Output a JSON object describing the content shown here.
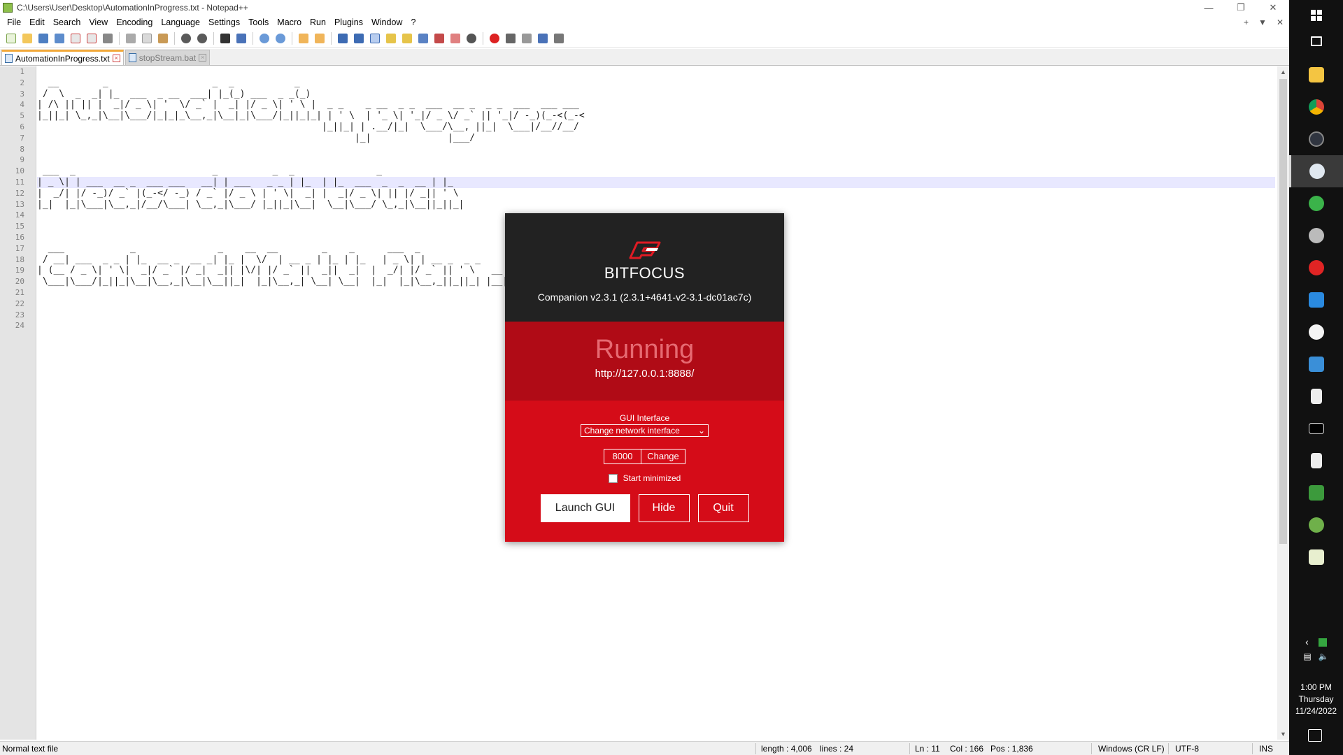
{
  "notepad": {
    "window_title": "C:\\Users\\User\\Desktop\\AutomationInProgress.txt - Notepad++",
    "menu": [
      "File",
      "Edit",
      "Search",
      "View",
      "Encoding",
      "Language",
      "Settings",
      "Tools",
      "Macro",
      "Run",
      "Plugins",
      "Window",
      "?"
    ],
    "tabs": [
      {
        "label": "AutomationInProgress.txt",
        "active": true
      },
      {
        "label": "stopStream.bat",
        "active": false
      }
    ],
    "line_numbers": [
      "1",
      "2",
      "3",
      "4",
      "5",
      "6",
      "7",
      "8",
      "9",
      "10",
      "11",
      "12",
      "13",
      "14",
      "15",
      "16",
      "17",
      "18",
      "19",
      "20",
      "21",
      "22",
      "23",
      "24"
    ],
    "current_line": 11,
    "lines": [
      "",
      "  __        _                   _  _           _",
      " /  \\  _  _| |_  ___  _ __  ___| |_(_) ___  _ _(_)",
      "| /\\ || || |  _|/ _ \\| '  \\/ _` |  _| |/ _ \\| ' \\ |  _ _    _ __  _ _  ___  __ _  _ _  ___  ___ ___",
      "|_||_| \\_,_|\\__|\\___/|_|_|_\\__,_|\\__|_|\\___/|_||_|_| | ' \\  | '_ \\| '_|/ _ \\/ _` || '_|/ -_)(_-<(_-<",
      "                                                    |_||_| | .__/|_|  \\___/\\__, ||_|  \\___|/__//__/",
      "                                                          |_|              |___/",
      "",
      "",
      " ___  _                         _          _  _               _",
      "| _ \\| | ___  __ _  ___ ___   __| | ___   _ _ | |_  | |_  ___  _  _  __ | |_",
      "|  _/| |/ -_)/ _` |(_-</ -_) / _` |/ _ \\ | ' \\|  _| |  _|/ _ \\| || |/ _|| ' \\",
      "|_|  |_|\\___|\\__,_|/__/\\___| \\__,_|\\___/ |_||_|\\__|  \\__|\\___/ \\_,_|\\__||_||_|",
      "",
      "",
      "",
      "  ___            _               _    __  __        _    _      ___  _                    ___  ___  ___  ___",
      " / __| ___  _ _ | |_  __ _  __ _| |_ |  \\/  | __ _ | |_ | |_   | _ \\| | __ _  _ _        |__ /|_  )|_  )|_  )",
      "| (__ / _ \\| ' \\|  _|/ _` |/ _|  _|| |\\/| |/ _` ||  _||  _|  |  _/| |/ _` || ' \\   __   |_ \\ / /  / /  / /",
      " \\___|\\___/|_||_|\\__|\\__,_|\\__|\\__||_|  |_|\\__,_| \\__| \\__|  |_|  |_|\\__,_||_||_| |__| |___//_/  /_/  /_/",
      "",
      "",
      "",
      ""
    ],
    "status": {
      "file_type": "Normal text file",
      "length": "length : 4,006",
      "lines": "lines : 24",
      "ln": "Ln : 11",
      "col": "Col : 166",
      "pos": "Pos : 1,836",
      "eol": "Windows (CR LF)",
      "encoding": "UTF-8",
      "mode": "INS"
    }
  },
  "companion": {
    "brand": "BITFOCUS",
    "version": "Companion v2.3.1 (2.3.1+4641-v2-3.1-dc01ac7c)",
    "state": "Running",
    "url": "http://127.0.0.1:8888/",
    "gui_interface_label": "GUI Interface",
    "interface_select": "Change network interface",
    "port": "8000",
    "change_label": "Change",
    "start_minimized_label": "Start minimized",
    "start_minimized_checked": false,
    "launch_label": "Launch GUI",
    "hide_label": "Hide",
    "quit_label": "Quit",
    "colors": {
      "header": "#222222",
      "status": "#b00b16",
      "body": "#d50c18",
      "state_text": "#e66a72"
    }
  },
  "taskbar": {
    "time": "1:00 PM",
    "day": "Thursday",
    "date": "11/24/2022",
    "apps": [
      "task-view-icon",
      "file-explorer-icon",
      "chrome-icon",
      "obs-icon",
      "notepadpp-icon",
      "upload-icon",
      "network-icon",
      "record-icon",
      "vscode-icon",
      "clock-app-icon",
      "vnc-icon",
      "spreadsheet-icon",
      "terminal-icon",
      "battery-app-icon",
      "cube-app-icon",
      "dragon-app-icon",
      "chart-app-icon"
    ]
  }
}
